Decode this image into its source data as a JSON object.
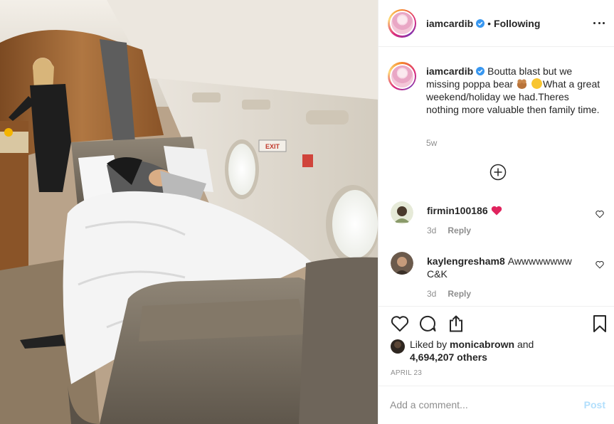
{
  "post": {
    "author": {
      "username": "iamcardib",
      "following_label": "Following",
      "separator": "•"
    },
    "caption": {
      "username": "iamcardib",
      "text_part1": "Boutta blast but we missing poppa bear",
      "text_part2": "What a great weekend/holiday we had.Theres nothing more valuable then family time.",
      "time": "5w"
    },
    "comments": [
      {
        "username": "firmin100186",
        "text": "",
        "age": "3d",
        "reply_label": "Reply"
      },
      {
        "username": "kaylengresham8",
        "text": "Awwwwwwww C&K",
        "age": "3d",
        "reply_label": "Reply"
      }
    ],
    "likes": {
      "prefix": "Liked by",
      "user": "monicabrown",
      "joiner": "and",
      "others": "4,694,207 others"
    },
    "date": "APRIL 23",
    "add_comment": {
      "placeholder": "Add a comment...",
      "post_label": "Post"
    }
  },
  "colors": {
    "verified": "#3897f0",
    "link_post_disabled": "#b2dffc",
    "muted": "#8e8e8e",
    "heart": "#ed4956"
  },
  "icons": [
    "verified-badge-icon",
    "more-options-icon",
    "add-circle-icon",
    "heart-icon",
    "comment-icon",
    "share-icon",
    "bookmark-icon",
    "red-heart-emoji",
    "bear-emoji",
    "sad-face-emoji"
  ]
}
